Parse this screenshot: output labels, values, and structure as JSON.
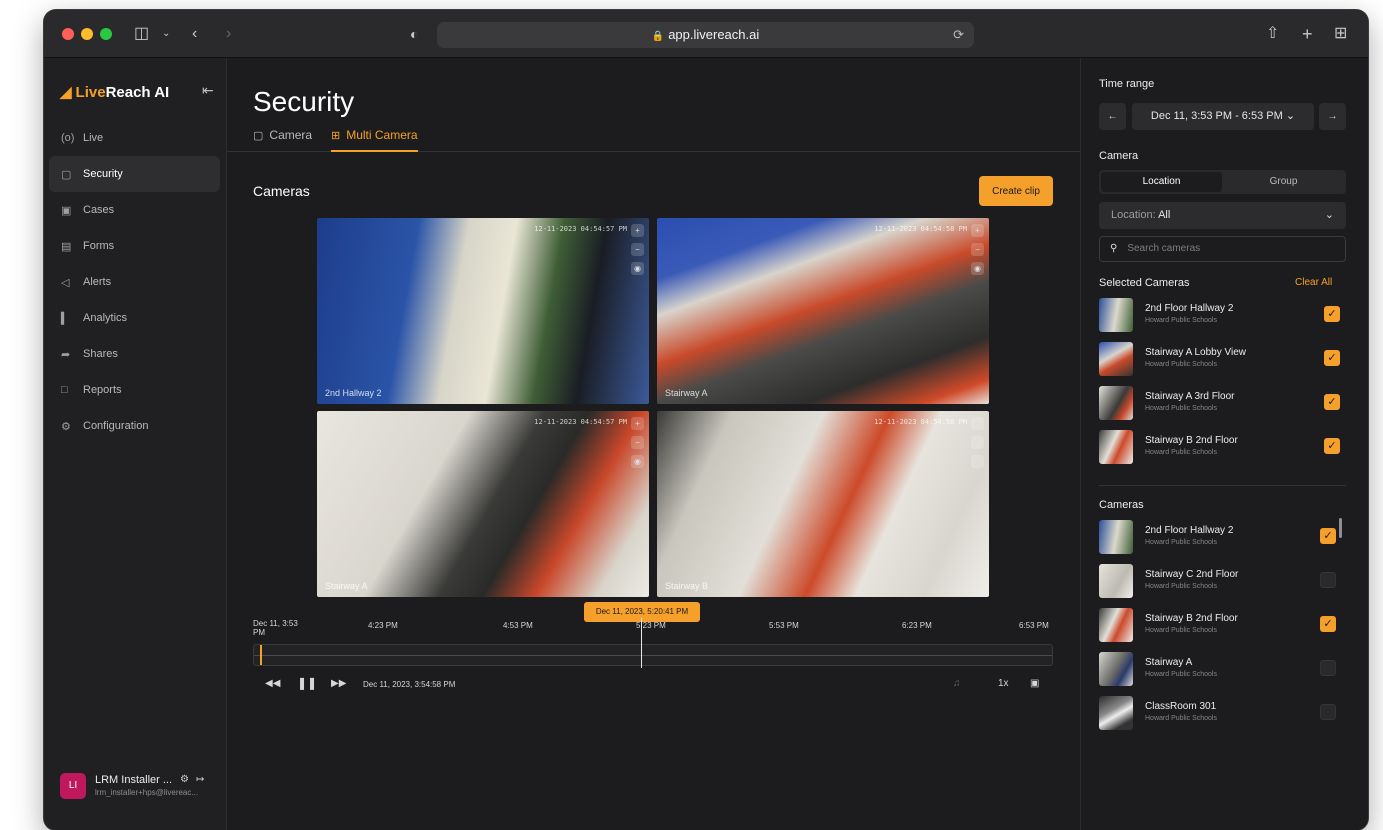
{
  "browser": {
    "url": "app.livereach.ai"
  },
  "sidebar": {
    "logo_brand": "Live",
    "logo_rest": "Reach AI",
    "items": [
      {
        "label": "Live",
        "icon": "live-icon"
      },
      {
        "label": "Security",
        "icon": "camera-icon"
      },
      {
        "label": "Cases",
        "icon": "folder-icon"
      },
      {
        "label": "Forms",
        "icon": "form-icon"
      },
      {
        "label": "Alerts",
        "icon": "megaphone-icon"
      },
      {
        "label": "Analytics",
        "icon": "analytics-icon"
      },
      {
        "label": "Shares",
        "icon": "share-icon"
      },
      {
        "label": "Reports",
        "icon": "report-icon"
      },
      {
        "label": "Configuration",
        "icon": "gear-icon"
      }
    ],
    "active": "Security",
    "user": {
      "initials": "LI",
      "name": "LRM Installer ...",
      "email": "lrm_installer+hps@livereac..."
    }
  },
  "main": {
    "title": "Security",
    "tabs": [
      {
        "label": "Camera",
        "icon": "camera-icon"
      },
      {
        "label": "Multi Camera",
        "icon": "grid-icon"
      }
    ],
    "active_tab": "Multi Camera",
    "section_title": "Cameras",
    "create_clip": "Create clip",
    "feeds": [
      {
        "timestamp": "12-11-2023 04:54:57 PM",
        "label": "2nd Hallway 2"
      },
      {
        "timestamp": "12-11-2023 04:54:58 PM",
        "label": "Stairway A"
      },
      {
        "timestamp": "12-11-2023 04:54:57 PM",
        "label": "Stairway A"
      },
      {
        "timestamp": "12-11-2023 04:54:58 PM",
        "label": "Stairway B"
      }
    ]
  },
  "timeline": {
    "start_line1": "Dec 11, 3:53",
    "start_line2": "PM",
    "ticks": [
      "4:23 PM",
      "4:53 PM",
      "5:23 PM",
      "5:53 PM",
      "6:23 PM",
      "6:53 PM"
    ],
    "cursor_label": "Dec 11, 2023, 5:20:41 PM",
    "current_time": "Dec 11, 2023, 3:54:58 PM",
    "speed": "1x"
  },
  "right_panel": {
    "time_range_label": "Time range",
    "time_range_value": "Dec 11, 3:53 PM - 6:53 PM",
    "camera_label": "Camera",
    "segments": [
      "Location",
      "Group"
    ],
    "active_segment": "Location",
    "location_prefix": "Location: ",
    "location_value": "All",
    "search_placeholder": "Search cameras",
    "selected_label": "Selected Cameras",
    "clear_all": "Clear All",
    "selected": [
      {
        "name": "2nd Floor Hallway 2",
        "org": "Howard Public Schools",
        "checked": true
      },
      {
        "name": "Stairway A Lobby View",
        "org": "Howard Public Schools",
        "checked": true
      },
      {
        "name": "Stairway A 3rd Floor",
        "org": "Howard Public Schools",
        "checked": true
      },
      {
        "name": "Stairway B 2nd Floor",
        "org": "Howard Public Schools",
        "checked": true
      }
    ],
    "cameras_label": "Cameras",
    "cameras": [
      {
        "name": "2nd Floor Hallway 2",
        "org": "Howard Public Schools",
        "checked": true
      },
      {
        "name": "Stairway C 2nd Floor",
        "org": "Howard Public Schools",
        "checked": false
      },
      {
        "name": "Stairway B 2nd Floor",
        "org": "Howard Public Schools",
        "checked": true
      },
      {
        "name": "Stairway A",
        "org": "Howard Public Schools",
        "checked": false
      },
      {
        "name": "ClassRoom 301",
        "org": "Howard Public Schools",
        "checked": false
      }
    ]
  },
  "colors": {
    "accent": "#f5a02a",
    "background": "#1c1c1e",
    "sidebar": "#202022"
  }
}
